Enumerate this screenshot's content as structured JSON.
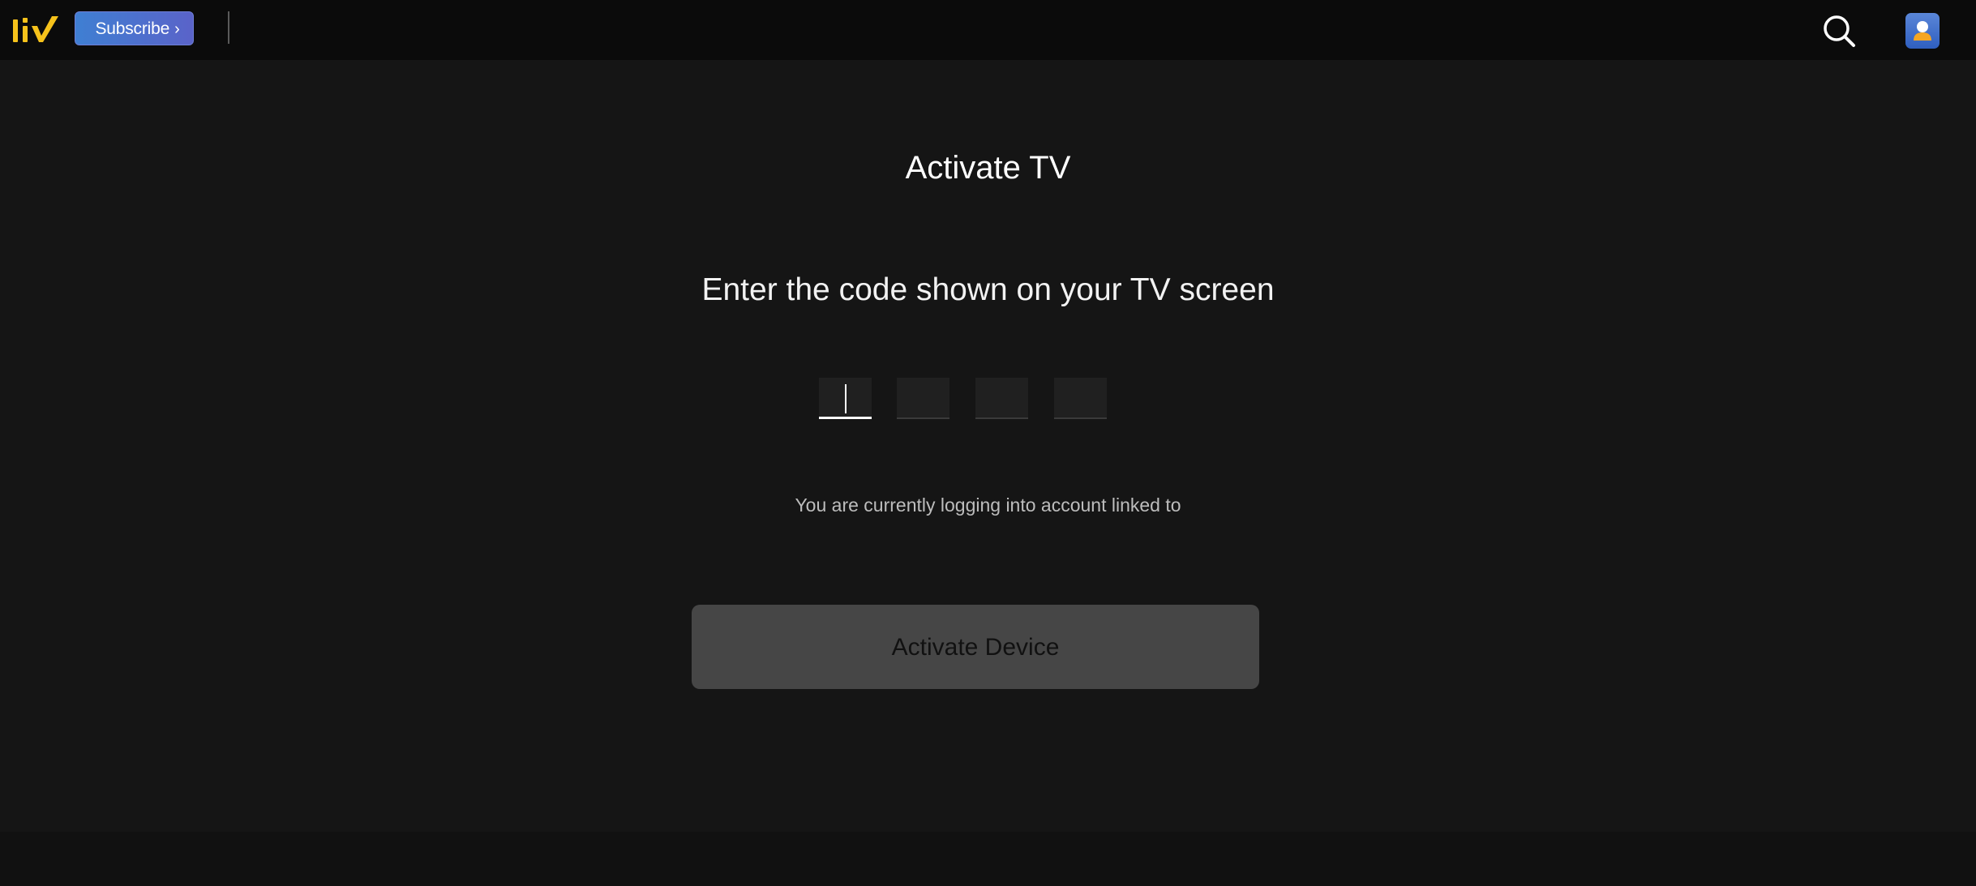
{
  "header": {
    "logo_alt": "liv",
    "subscribe_label": "Subscribe",
    "subscribe_chevron": "›",
    "search_icon": "search-icon",
    "profile_icon": "user-avatar-icon"
  },
  "main": {
    "title": "Activate TV",
    "subtitle": "Enter the code shown on your TV screen",
    "code_inputs": [
      {
        "value": "",
        "focused": true
      },
      {
        "value": "",
        "focused": false
      },
      {
        "value": "",
        "focused": false
      },
      {
        "value": "",
        "focused": false
      }
    ],
    "account_note": "You are currently logging into account linked to",
    "activate_label": "Activate Device"
  },
  "colors": {
    "page_background": "#151515",
    "header_background": "#0b0b0b",
    "logo_yellow": "#f6c21b",
    "subscribe_gradient_start": "#3f7fd2",
    "subscribe_gradient_end": "#5a63c9",
    "avatar_blue": "#3f6fcf",
    "button_background": "#464646"
  }
}
